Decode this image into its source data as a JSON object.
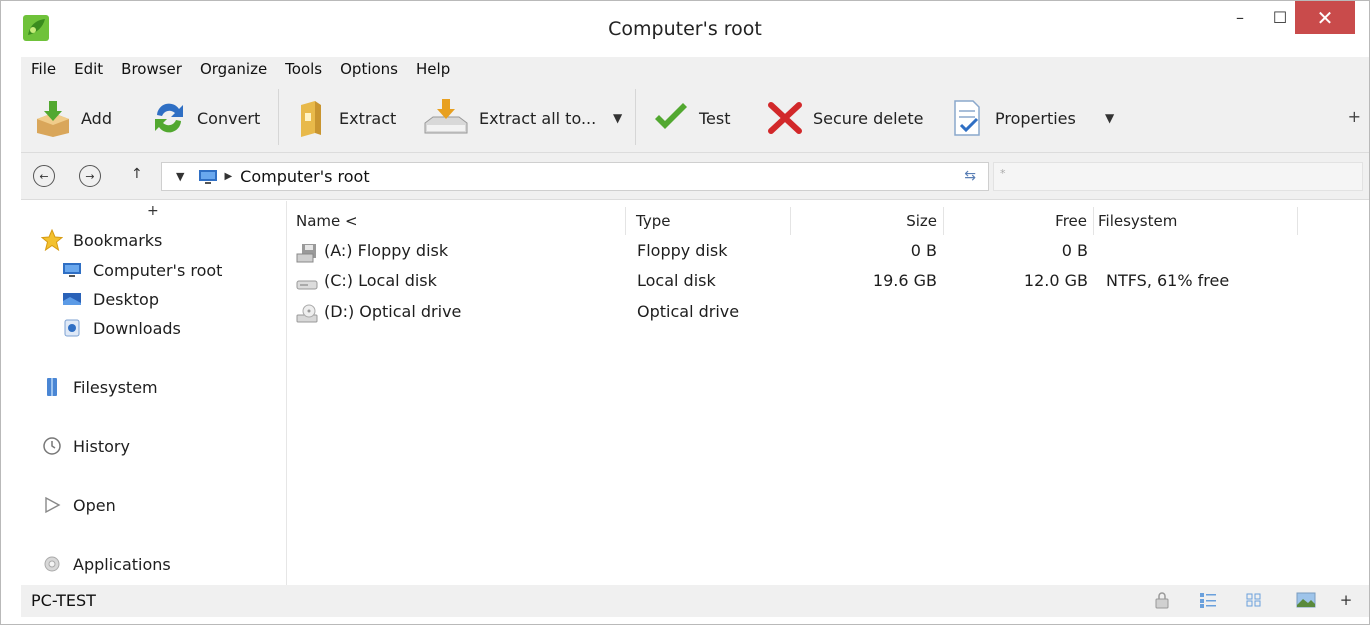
{
  "window": {
    "title": "Computer's root",
    "controls": {
      "minimize": "–",
      "maximize": "☐",
      "close": "✕"
    }
  },
  "menu": [
    "File",
    "Edit",
    "Browser",
    "Organize",
    "Tools",
    "Options",
    "Help"
  ],
  "toolbar": {
    "add": "Add",
    "convert": "Convert",
    "extract": "Extract",
    "extract_all": "Extract all to...",
    "test": "Test",
    "secure_delete": "Secure delete",
    "properties": "Properties",
    "dropdown_glyph": "▼",
    "plus": "+"
  },
  "address": {
    "path": "Computer's root",
    "filter_placeholder": "*",
    "back_glyph": "←",
    "forward_glyph": "→",
    "up_glyph": "↑",
    "dropdown_glyph": "▼",
    "separator_glyph": "▶",
    "refresh_glyph": "⇆"
  },
  "sidebar": {
    "plus": "+",
    "bookmarks": "Bookmarks",
    "bookmark_items": [
      "Computer's root",
      "Desktop",
      "Downloads"
    ],
    "filesystem": "Filesystem",
    "history": "History",
    "open": "Open",
    "applications": "Applications"
  },
  "filelist": {
    "columns": [
      "Name <",
      "Type",
      "Size",
      "Free",
      "Filesystem"
    ],
    "rows": [
      {
        "name": "(A:) Floppy disk",
        "type": "Floppy disk",
        "size": "0 B",
        "free": "0 B",
        "filesystem": "",
        "icon": "floppy-icon"
      },
      {
        "name": "(C:) Local disk",
        "type": "Local disk",
        "size": "19.6 GB",
        "free": "12.0 GB",
        "filesystem": "NTFS, 61% free",
        "icon": "hard-disk-icon"
      },
      {
        "name": "(D:) Optical drive",
        "type": "Optical drive",
        "size": "",
        "free": "",
        "filesystem": "",
        "icon": "optical-drive-icon"
      }
    ]
  },
  "status": {
    "computer_name": "PC-TEST",
    "plus": "+"
  },
  "colors": {
    "chrome_bg": "#f0f0f0",
    "close_red": "#c94b4b",
    "accent_green": "#52a830",
    "delete_red": "#d2282a",
    "folder_blue": "#2f6fc4"
  }
}
